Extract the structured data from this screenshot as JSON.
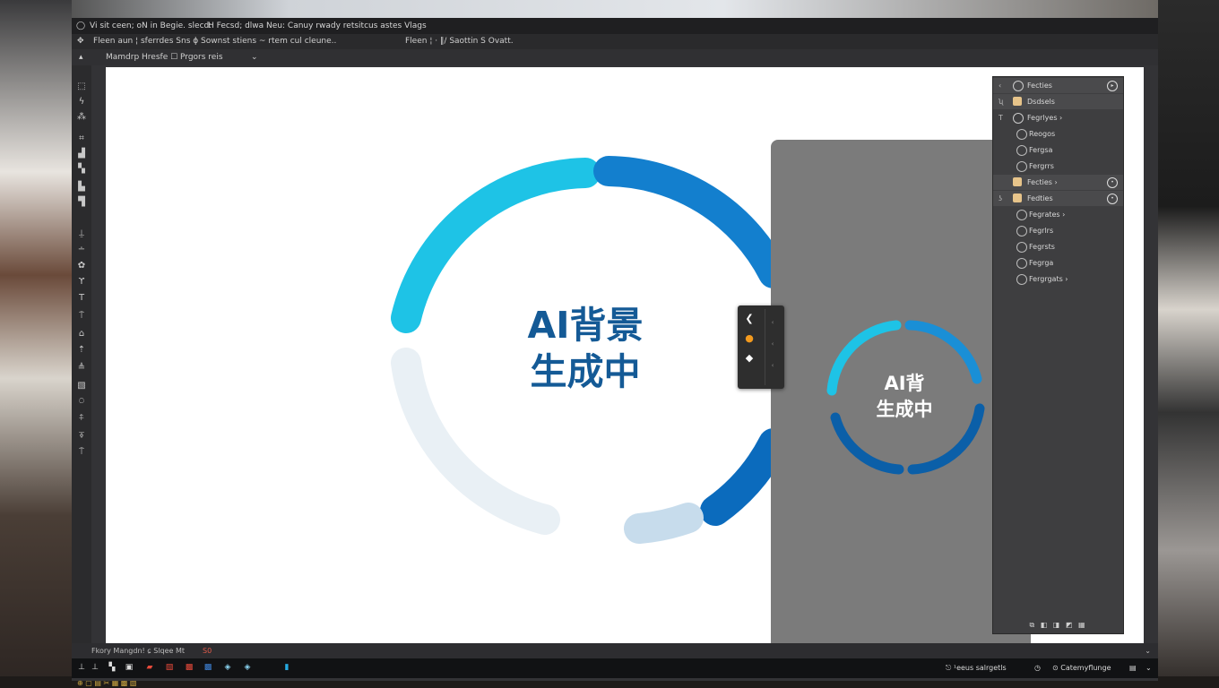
{
  "window": {
    "menubar_text": "Vi sit ceen; oN in Begie. slecd:",
    "menubar_text_2": "H   Fecsd; dlwa Neu: Canuy rwady retsitcus astes Vlags"
  },
  "options_bar": {
    "left": "Fleen aun ¦ sferrdes Sns ɸ Sownst stiens ~ rtem cul cleune..",
    "right": "Fleen ¦ ·  ‖/  Saottin S Ovatt."
  },
  "breadcrumb": {
    "text": "Mamdrp Hresfe  ☐  Prgors reis",
    "chevron": "⌄"
  },
  "canvas": {
    "ring_colors": [
      "#1ec3e6",
      "#137fce",
      "#0b6bbd",
      "#c7dcec",
      "#e9f0f5"
    ],
    "main_text_line1": "AI背景",
    "main_text_line2": "生成中",
    "main_text_color": "#145a96"
  },
  "preview": {
    "text_line1": "AI背",
    "text_line2": "生成中",
    "arrow": "›",
    "ring_colors": [
      "#1ec3e6",
      "#1a8fd6",
      "#0b5fa8"
    ]
  },
  "floating_toolbar": {
    "items": [
      "❮",
      "●",
      "◆"
    ],
    "mini": [
      "‹",
      "‹",
      "‹"
    ]
  },
  "layers_panel": {
    "rows": [
      {
        "label": "Fecties",
        "left": "‹",
        "right_icon": true,
        "highlight": true
      },
      {
        "label": "Dsdsels",
        "left": "ʯ",
        "right_icon": false,
        "highlight": true
      },
      {
        "label": "Fegrlyes ›",
        "left": "T",
        "right_icon": false,
        "highlight": false
      },
      {
        "label": "Reogos",
        "left": "",
        "right_icon": false,
        "highlight": false
      },
      {
        "label": "Fergsa",
        "left": "",
        "right_icon": false,
        "highlight": false
      },
      {
        "label": "Fergrrs",
        "left": "",
        "right_icon": false,
        "highlight": false
      },
      {
        "label": "Fecties ›",
        "left": "",
        "right_icon": true,
        "highlight": true
      },
      {
        "label": "Fedties",
        "left": "ʖ",
        "right_icon": true,
        "highlight": true
      },
      {
        "label": "Fegrates ›",
        "left": "",
        "right_icon": false,
        "highlight": false
      },
      {
        "label": "Fegrlrs",
        "left": "",
        "right_icon": false,
        "highlight": false
      },
      {
        "label": "Fegrsts",
        "left": "",
        "right_icon": false,
        "highlight": false
      },
      {
        "label": "Fegrga",
        "left": "",
        "right_icon": false,
        "highlight": false
      },
      {
        "label": "Fergrgats ›",
        "left": "",
        "right_icon": false,
        "highlight": false
      }
    ],
    "footer": "⧉ ◧ ◨ ◩ ▦"
  },
  "status_bar": {
    "text": "Fkory Mangdn! ɕ Slqee Mt",
    "accent": "S0",
    "arrow": "⌄"
  },
  "taskbar": {
    "icons": [
      "⊥",
      "⊥",
      "▚",
      "▣",
      "▰",
      "▧",
      "▩",
      "▩",
      "◈",
      "◈",
      "▮"
    ],
    "icon_colors": [
      "#dddddd",
      "#dddddd",
      "#dddddd",
      "#e0e0e0",
      "#e74a3b",
      "#e74a3b",
      "#e74a3b",
      "#3f83d8",
      "#8ad3f0",
      "#8ad3f0",
      "#25a9e0"
    ],
    "right_items": [
      "⎋ ¹eeus salrgetls",
      "◷",
      "⊙ Catemyflunge",
      "▤",
      "⌄"
    ]
  },
  "bottom_strip": "⊕ ▢  ▤  ✂  ▦  ▩  ▧"
}
